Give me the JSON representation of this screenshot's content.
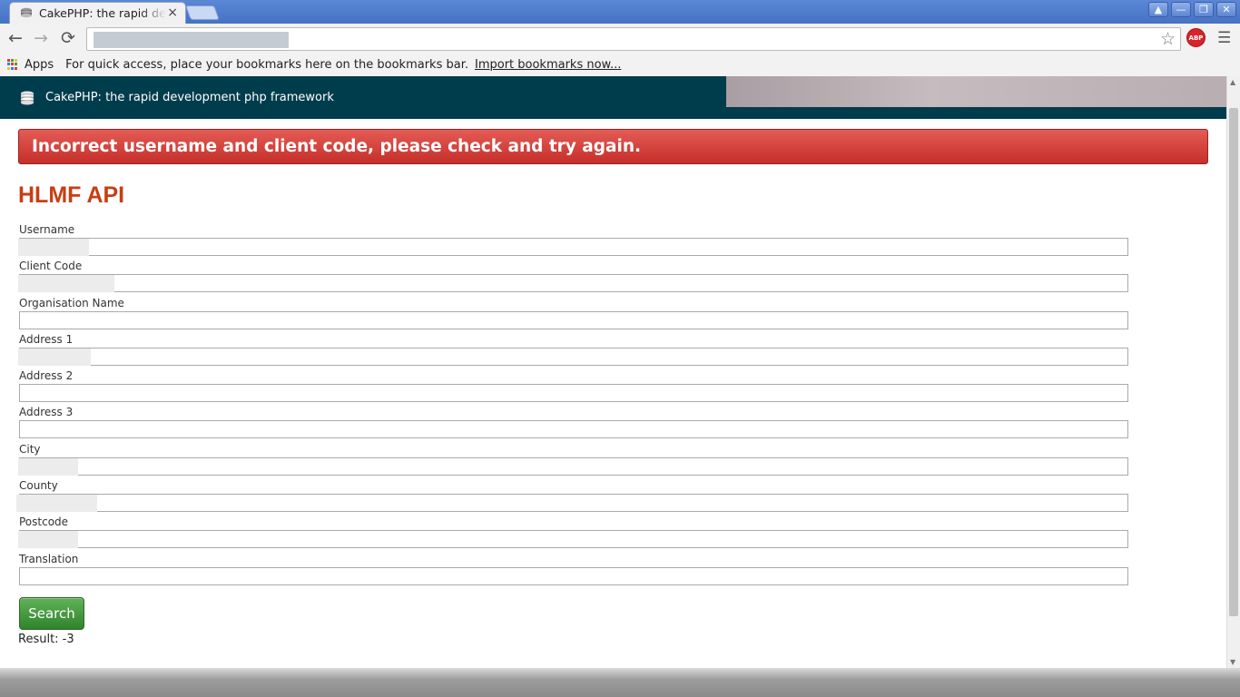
{
  "browser": {
    "tab_title": "CakePHP: the rapid development php framework",
    "tab_close": "×",
    "back_icon": "←",
    "forward_icon": "→",
    "reload_icon": "⟳",
    "star_icon": "☆",
    "abp_label": "ABP",
    "menu_icon": "☰",
    "window_buttons": [
      "▲",
      "—",
      "❐",
      "✕"
    ]
  },
  "bookmarks_bar": {
    "apps_label": "Apps",
    "message": "For quick access, place your bookmarks here on the bookmarks bar.",
    "import_link": "Import bookmarks now..."
  },
  "header": {
    "site_title": "CakePHP: the rapid development php framework"
  },
  "flash": {
    "message": "Incorrect username and client code, please check and try again."
  },
  "page": {
    "title": "HLMF API"
  },
  "form": {
    "fields": [
      {
        "label": "Username",
        "value": ""
      },
      {
        "label": "Client Code",
        "value": ""
      },
      {
        "label": "Organisation Name",
        "value": ""
      },
      {
        "label": "Address 1",
        "value": ""
      },
      {
        "label": "Address 2",
        "value": ""
      },
      {
        "label": "Address 3",
        "value": ""
      },
      {
        "label": "City",
        "value": ""
      },
      {
        "label": "County",
        "value": ""
      },
      {
        "label": "Postcode",
        "value": ""
      },
      {
        "label": "Translation",
        "value": ""
      }
    ],
    "submit_label": "Search",
    "result_text": "Result: -3"
  },
  "colors": {
    "header_bg": "#003d4c",
    "flash_bg": "#d9423d",
    "title_color": "#c73e14",
    "button_bg": "#3f963a"
  }
}
